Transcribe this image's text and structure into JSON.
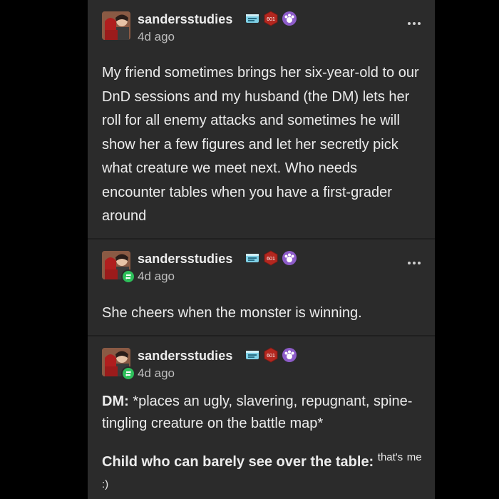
{
  "posts": [
    {
      "username": "sandersstudies",
      "time": "4d ago",
      "reblog": false,
      "text": "My friend sometimes brings her six-year-old to our DnD sessions and my husband (the DM) lets her roll for all enemy attacks and sometimes he will show her a few figures and let her secretly pick what creature we meet next. Who needs encounter tables when you have a first-grader around"
    },
    {
      "username": "sandersstudies",
      "time": "4d ago",
      "reblog": true,
      "text": "She cheers when the monster is winning."
    },
    {
      "username": "sandersstudies",
      "time": "4d ago",
      "reblog": true,
      "dm_label": "DM:",
      "dm_text": " *places an ugly, slavering, repugnant, spine-tingling creature on the battle map*",
      "child_label": "Child who can barely see over the table:",
      "child_small": "that's",
      "child_rest": "me :)"
    }
  ],
  "badges": {
    "badge_1_icon": "scroll-badge-icon",
    "badge_2_icon": "d20-badge-icon",
    "badge_2_text": "601",
    "badge_3_icon": "paw-badge-icon"
  },
  "icons": {
    "more": "more-options-icon",
    "reblog": "reblog-icon"
  },
  "colors": {
    "background": "#000000",
    "card": "#2b2b2b",
    "text": "#ececec",
    "muted": "#bdbdbd",
    "reblog_green": "#2dbf5a",
    "d20_red": "#b3271f",
    "paw_purple": "#8d5cc9"
  }
}
